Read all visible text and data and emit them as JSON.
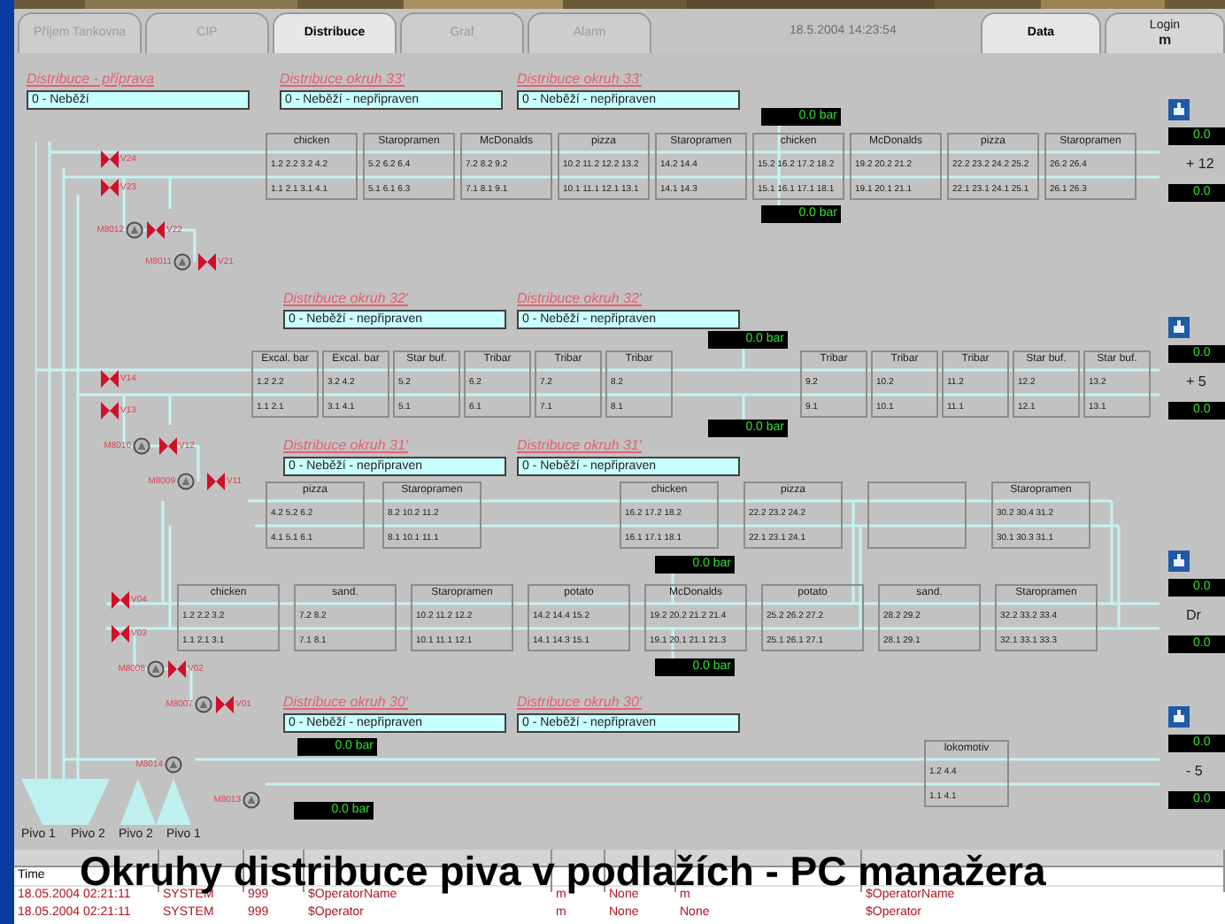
{
  "tabs": [
    {
      "label": "Příjem Tankovna",
      "selected": false
    },
    {
      "label": "CIP",
      "selected": false
    },
    {
      "label": "Distribuce",
      "selected": true
    },
    {
      "label": "Graf",
      "selected": false
    },
    {
      "label": "Alarm",
      "selected": false
    }
  ],
  "datetime": "18.5.2004 14:23:54",
  "right_tabs": [
    {
      "label": "Data",
      "selected": true
    },
    {
      "label": "Login",
      "value": "m",
      "selected": false
    }
  ],
  "circuits": [
    {
      "label": "Distribuce - příprava",
      "status": "0 - Neběží"
    },
    {
      "label": "Distribuce okruh 33'",
      "status": "0 - Neběží - nepřipraven"
    },
    {
      "label": "Distribuce okruh 33'",
      "status": "0 - Neběží - nepřipraven"
    },
    {
      "label": "Distribuce okruh 32'",
      "status": "0 - Neběží - nepřipraven"
    },
    {
      "label": "Distribuce okruh 32'",
      "status": "0 - Neběží - nepřipraven"
    },
    {
      "label": "Distribuce okruh 31'",
      "status": "0 - Neběží - nepřipraven"
    },
    {
      "label": "Distribuce okruh 31'",
      "status": "0 - Neběží - nepřipraven"
    },
    {
      "label": "Distribuce okruh 30'",
      "status": "0 - Neběží - nepřipraven"
    },
    {
      "label": "Distribuce okruh 30'",
      "status": "0 - Neběží - nepřipraven"
    }
  ],
  "station_rows": [
    {
      "stations": [
        {
          "kind": "station",
          "name": "chicken",
          "line_1": "1.2 2.2 3.2 4.2",
          "line_2": "1.1 2.1 3.1 4.1"
        },
        {
          "kind": "station",
          "name": "Staropramen",
          "line_1": "5.2 6.2 6.4",
          "line_2": "5.1 6.1 6.3"
        },
        {
          "kind": "station",
          "name": "McDonalds",
          "line_1": "7.2 8.2 9.2",
          "line_2": "7.1 8.1 9.1"
        },
        {
          "kind": "station",
          "name": "pizza",
          "line_1": "10.2 11.2 12.2 13.2",
          "line_2": "10.1 11.1 12.1 13.1"
        },
        {
          "kind": "station",
          "name": "Staropramen",
          "line_1": "14.2 14.4",
          "line_2": "14.1 14.3"
        },
        {
          "kind": "station",
          "name": "chicken",
          "line_1": "15.2 16.2 17.2 18.2",
          "line_2": "15.1 16.1 17.1 18.1"
        },
        {
          "kind": "station",
          "name": "McDonalds",
          "line_1": "19.2 20.2 21.2",
          "line_2": "19.1 20.1 21.1"
        },
        {
          "kind": "station",
          "name": "pizza",
          "line_1": "22.2 23.2 24.2 25.2",
          "line_2": "22.1 23.1 24.1 25.1"
        },
        {
          "kind": "station",
          "name": "Staropramen",
          "line_1": "26.2 26.4",
          "line_2": "26.1 26.3"
        }
      ]
    },
    {
      "stations": [
        {
          "kind": "station",
          "name": "Excal. bar",
          "line_1": "1.2 2.2",
          "line_2": "1.1 2.1"
        },
        {
          "kind": "station",
          "name": "Excal. bar",
          "line_1": "3.2 4.2",
          "line_2": "3.1 4.1"
        },
        {
          "kind": "station",
          "name": "Star buf.",
          "line_1": "5.2",
          "line_2": "5.1"
        },
        {
          "kind": "station",
          "name": "Tribar",
          "line_1": "6.2",
          "line_2": "6.1"
        },
        {
          "kind": "station",
          "name": "Tribar",
          "line_1": "7.2",
          "line_2": "7.1"
        },
        {
          "kind": "station",
          "name": "Tribar",
          "line_1": "8.2",
          "line_2": "8.1"
        },
        {
          "kind": "station",
          "name": "Tribar",
          "line_1": "9.2",
          "line_2": "9.1"
        },
        {
          "kind": "station",
          "name": "Tribar",
          "line_1": "10.2",
          "line_2": "10.1"
        },
        {
          "kind": "station",
          "name": "Tribar",
          "line_1": "11.2",
          "line_2": "11.1"
        },
        {
          "kind": "station",
          "name": "Star buf.",
          "line_1": "12.2",
          "line_2": "12.1"
        },
        {
          "kind": "station",
          "name": "Star buf.",
          "line_1": "13.2",
          "line_2": "13.1"
        }
      ]
    },
    {
      "stations": [
        {
          "kind": "station",
          "name": "pizza",
          "line_1": "4.2 5.2 6.2",
          "line_2": "4.1 5.1 6.1"
        },
        {
          "kind": "station",
          "name": "Staropramen",
          "line_1": "8.2 10.2 11.2",
          "line_2": "8.1 10.1 11.1"
        },
        {
          "kind": "station",
          "name": "chicken",
          "line_1": "16.2 17.2 18.2",
          "line_2": "16.1 17.1 18.1"
        },
        {
          "kind": "station",
          "name": "pizza",
          "line_1": "22.2 23.2 24.2",
          "line_2": "22.1 23.1 24.1"
        },
        {
          "kind": "empty"
        },
        {
          "kind": "station",
          "name": "Staropramen",
          "line_1": "30.2 30.4 31.2",
          "line_2": "30.1 30.3 31.1"
        }
      ]
    },
    {
      "stations": [
        {
          "kind": "station",
          "name": "chicken",
          "line_1": "1.2 2.2 3.2",
          "line_2": "1.1 2.1 3.1"
        },
        {
          "kind": "station",
          "name": "sand.",
          "line_1": "7.2 8.2",
          "line_2": "7.1 8.1"
        },
        {
          "kind": "station",
          "name": "Staropramen",
          "line_1": "10.2 11.2 12.2",
          "line_2": "10.1 11.1 12.1"
        },
        {
          "kind": "station",
          "name": "potato",
          "line_1": "14.2 14.4 15.2",
          "line_2": "14.1 14.3 15.1"
        },
        {
          "kind": "station",
          "name": "McDonalds",
          "line_1": "19.2 20.2 21.2 21.4",
          "line_2": "19.1 20.1 21.1 21.3"
        },
        {
          "kind": "station",
          "name": "potato",
          "line_1": "25.2 26.2 27.2",
          "line_2": "25.1 26.1 27.1"
        },
        {
          "kind": "station",
          "name": "sand.",
          "line_1": "28.2 29.2",
          "line_2": "28.1 29.1"
        },
        {
          "kind": "station",
          "name": "Staropramen",
          "line_1": "32.2 33.2 33.4",
          "line_2": "32.1 33.1 33.3"
        }
      ]
    },
    {
      "stations": [
        {
          "kind": "station",
          "name": "lokomotiv",
          "line_1": "1.2 4.4",
          "line_2": "1.1 4.1"
        }
      ]
    }
  ],
  "pressures": [
    "0.0 bar",
    "0.0 bar",
    "0.0 bar",
    "0.0 bar",
    "0.0 bar",
    "0.0 bar",
    "0.0 bar",
    "0.0 bar"
  ],
  "outlet_readings": [
    "0.0",
    "0.0",
    "0.0",
    "0.0",
    "0.0",
    "0.0",
    "0.0",
    "0.0"
  ],
  "outlet_labels": [
    "+ 12",
    "+ 5",
    "Dr",
    "- 5"
  ],
  "valves": [
    {
      "kind": "valve",
      "label": "V24"
    },
    {
      "kind": "valve",
      "label": "V23"
    },
    {
      "kind": "pump",
      "label": "M8012"
    },
    {
      "kind": "valve",
      "label": "V22"
    },
    {
      "kind": "pump",
      "label": "M8011"
    },
    {
      "kind": "valve",
      "label": "V21"
    },
    {
      "kind": "valve",
      "label": "V14"
    },
    {
      "kind": "valve",
      "label": "V13"
    },
    {
      "kind": "pump",
      "label": "M8010"
    },
    {
      "kind": "valve",
      "label": "V12"
    },
    {
      "kind": "pump",
      "label": "M8009"
    },
    {
      "kind": "valve",
      "label": "V11"
    },
    {
      "kind": "valve",
      "label": "V04"
    },
    {
      "kind": "valve",
      "label": "V03"
    },
    {
      "kind": "pump",
      "label": "M8008"
    },
    {
      "kind": "valve",
      "label": "V02"
    },
    {
      "kind": "pump",
      "label": "M8007"
    },
    {
      "kind": "valve",
      "label": "V01"
    },
    {
      "kind": "pump",
      "label": "M8014"
    },
    {
      "kind": "pump",
      "label": "M8013"
    }
  ],
  "tanks": [
    "Pivo 1",
    "Pivo 2",
    "Pivo 2",
    "Pivo 1"
  ],
  "event_table": {
    "columns": [
      "Time"
    ],
    "rows": [
      [
        "18.05.2004 02:21:11",
        "SYSTEM",
        "999",
        "$OperatorName",
        "m",
        "None",
        "m",
        "$OperatorName"
      ],
      [
        "18.05.2004 02:21:11",
        "SYSTEM",
        "999",
        "$Operator",
        "m",
        "None",
        "None",
        "$Operator"
      ]
    ]
  },
  "caption": "Okruhy distribuce piva v podlažích - PC manažera"
}
